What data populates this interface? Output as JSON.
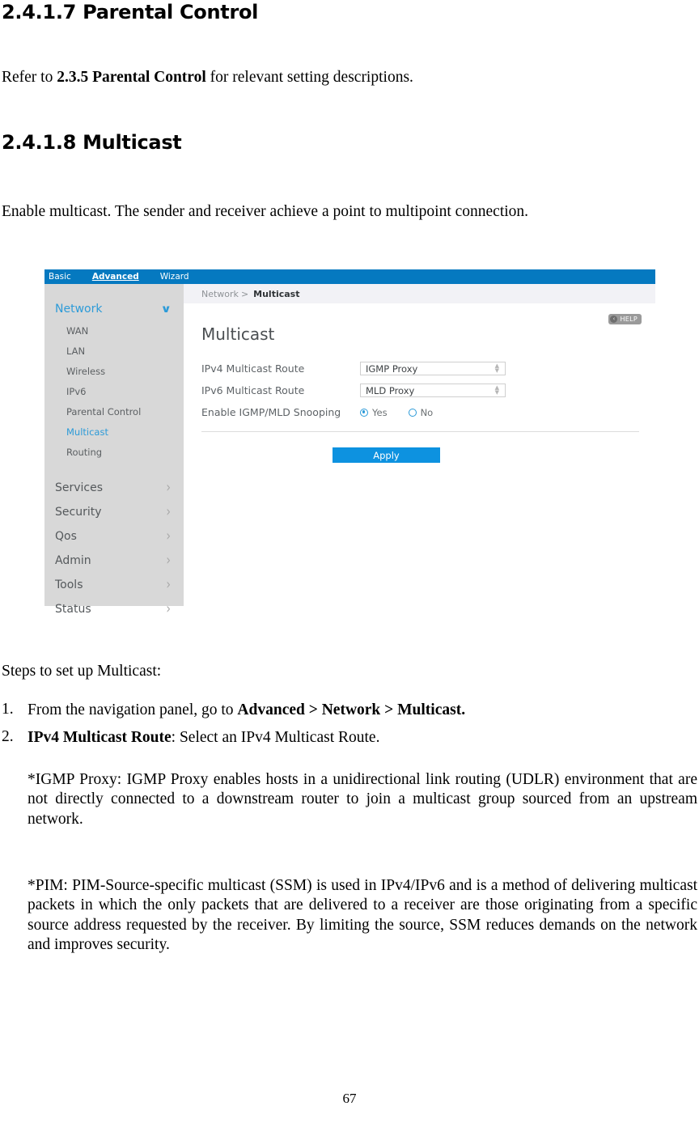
{
  "document": {
    "heading_parental": "2.4.1.7 Parental Control",
    "refer_prefix": "Refer to ",
    "refer_bold": "2.3.5 Parental Control",
    "refer_suffix": " for relevant setting descriptions.",
    "heading_multicast": "2.4.1.8 Multicast",
    "enable_para": "Enable multicast. The sender and receiver achieve a point to multipoint connection.",
    "steps_intro": "Steps to set up Multicast:",
    "steps": [
      {
        "number": "1.",
        "prefix": "From the navigation panel, go to ",
        "bold": "Advanced > Network > Multicast.",
        "suffix": ""
      },
      {
        "number": "2.",
        "prefix": "",
        "bold": "IPv4 Multicast Route",
        "suffix": ": Select an IPv4 Multicast Route."
      }
    ],
    "igmp_para": "*IGMP Proxy: IGMP Proxy enables hosts in a unidirectional link routing (UDLR) environment that are not directly connected to a downstream router to join a multicast group sourced from an upstream network.",
    "pim_para": "*PIM: PIM-Source-specific multicast (SSM) is used in IPv4/IPv6 and is a method of delivering multicast packets in which the only packets that are delivered to a receiver are those originating from a specific source address requested by the receiver. By limiting the source, SSM reduces demands on the network and improves security.",
    "page_number": "67"
  },
  "router_ui": {
    "top_tabs": [
      {
        "label": "Basic",
        "active": false
      },
      {
        "label": "Advanced",
        "active": true
      },
      {
        "label": "Wizard",
        "active": false
      }
    ],
    "sidebar": {
      "network_group": "Network",
      "chevron_down_icon": "∨",
      "chevron_right_icon": "›",
      "sub_items": [
        {
          "label": "WAN",
          "selected": false
        },
        {
          "label": "LAN",
          "selected": false
        },
        {
          "label": "Wireless",
          "selected": false
        },
        {
          "label": "IPv6",
          "selected": false
        },
        {
          "label": "Parental Control",
          "selected": false
        },
        {
          "label": "Multicast",
          "selected": true
        },
        {
          "label": "Routing",
          "selected": false
        }
      ],
      "groups": [
        {
          "label": "Services"
        },
        {
          "label": "Security"
        },
        {
          "label": "Qos"
        },
        {
          "label": "Admin"
        },
        {
          "label": "Tools"
        },
        {
          "label": "Status"
        }
      ]
    },
    "breadcrumb": {
      "root": "Network",
      "separator": ">",
      "current": "Multicast"
    },
    "page_title": "Multicast",
    "help_button": {
      "label": "HELP",
      "back_icon": "‹"
    },
    "fields": {
      "ipv4_label": "IPv4 Multicast Route",
      "ipv4_value": "IGMP Proxy",
      "ipv6_label": "IPv6 Multicast Route",
      "ipv6_value": "MLD Proxy",
      "snooping_label": "Enable IGMP/MLD Snooping",
      "snooping_yes": "Yes",
      "snooping_no": "No",
      "snooping_selected": "Yes"
    },
    "apply_label": "Apply",
    "colors": {
      "topbar_blue": "#0579c0",
      "accent_blue": "#2d9bd8",
      "apply_blue": "#0d92e0",
      "sidebar_gray": "#d8d8d8",
      "breadcrumb_gray": "#f2f2f6",
      "help_gray": "#9a9a9a"
    }
  }
}
